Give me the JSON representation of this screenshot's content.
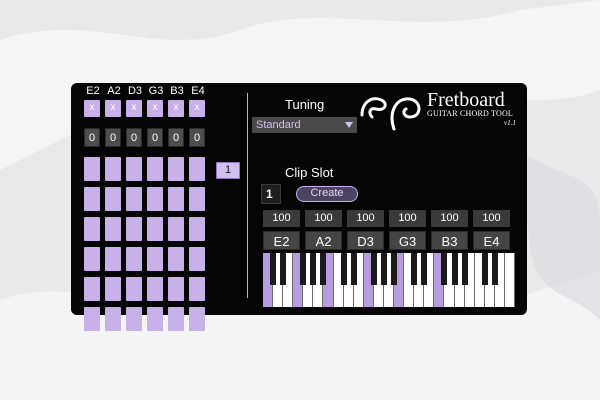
{
  "strings": [
    "E2",
    "A2",
    "D3",
    "G3",
    "B3",
    "E4"
  ],
  "mute_row": [
    "x",
    "x",
    "x",
    "x",
    "x",
    "x"
  ],
  "fret0_row": [
    "0",
    "0",
    "0",
    "0",
    "0",
    "0"
  ],
  "fret_rows": 6,
  "fret_position": "1",
  "tuning": {
    "label": "Tuning",
    "selected": "Standard"
  },
  "logo": {
    "title": "Fretboard",
    "subtitle": "GUITAR CHORD TOOL",
    "version": "v1.1"
  },
  "clip": {
    "label": "Clip Slot",
    "slot": "1",
    "button": "Create"
  },
  "velocities": [
    "100",
    "100",
    "100",
    "100",
    "100",
    "100"
  ],
  "notes": [
    "E2",
    "A2",
    "D3",
    "G3",
    "B3",
    "E4"
  ],
  "colors": {
    "accent": "#c7b1e8",
    "panel": "#050505",
    "highlight": "#b79ce0"
  }
}
